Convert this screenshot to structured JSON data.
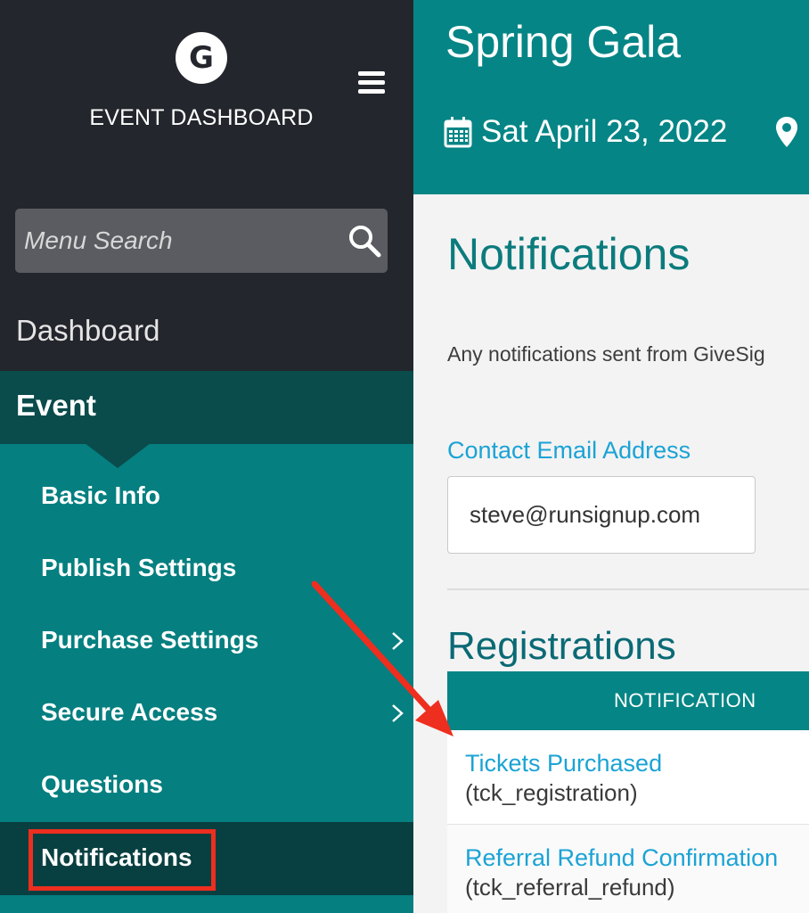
{
  "sidebar": {
    "logo_letter": "G",
    "brand_title": "EVENT DASHBOARD",
    "search": {
      "placeholder": "Menu Search"
    },
    "dashboard_label": "Dashboard",
    "event_label": "Event",
    "items": [
      {
        "label": "Basic Info",
        "has_chevron": false
      },
      {
        "label": "Publish Settings",
        "has_chevron": false
      },
      {
        "label": "Purchase Settings",
        "has_chevron": true
      },
      {
        "label": "Secure Access",
        "has_chevron": true
      },
      {
        "label": "Questions",
        "has_chevron": false
      },
      {
        "label": "Notifications",
        "has_chevron": false,
        "active": true
      }
    ]
  },
  "header": {
    "event_name": "Spring Gala",
    "date": "Sat April 23, 2022",
    "icons": [
      "calendar-icon",
      "map-pin-icon"
    ]
  },
  "main": {
    "page_title": "Notifications",
    "intro_text": "Any notifications sent from GiveSig",
    "contact_email_label": "Contact Email Address",
    "contact_email_value": "steve@runsignup.com",
    "registrations_title": "Registrations",
    "table": {
      "header": "NOTIFICATION",
      "rows": [
        {
          "name": "Tickets Purchased",
          "code": "(tck_registration)"
        },
        {
          "name": "Referral Refund Confirmation",
          "code": "(tck_referral_refund)"
        }
      ]
    }
  },
  "annotations": {
    "arrow_color": "#ee2e1f",
    "highlight_color": "#ee2e1f"
  },
  "colors": {
    "sidebar_bg": "#23262c",
    "teal": "#058586",
    "teal_dark": "#0a4b4b",
    "link_blue": "#1ba3d5"
  }
}
